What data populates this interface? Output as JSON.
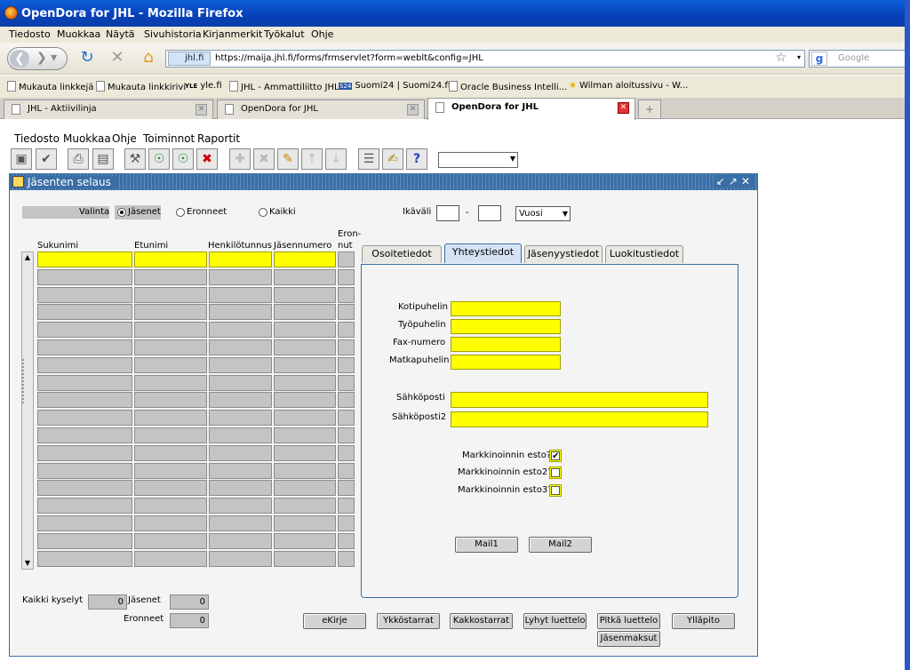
{
  "window": {
    "title": "OpenDora for JHL - Mozilla Firefox"
  },
  "browser_menu": [
    "Tiedosto",
    "Muokkaa",
    "Näytä",
    "Sivuhistoria",
    "Kirjanmerkit",
    "Työkalut",
    "Ohje"
  ],
  "address": {
    "site": "jhl.fi",
    "url": "https://maija.jhl.fi/forms/frmservlet?form=weblt&config=JHL"
  },
  "search": {
    "placeholder": "Google"
  },
  "bookmarks": [
    "Mukauta linkkejä",
    "Mukauta linkkirivi",
    "yle.fi",
    "JHL - Ammattiliitto JHL",
    "Suomi24 | Suomi24.fi",
    "Oracle Business Intelli...",
    "Wilman aloitussivu - W..."
  ],
  "bookmark_badges": {
    "yle": "YLE",
    "s24": "S24"
  },
  "tabs": [
    "JHL - Aktiivilinja",
    "OpenDora for JHL",
    "OpenDora for JHL"
  ],
  "app_menu": [
    "Tiedosto",
    "Muokkaa",
    "Ohje",
    "Toiminnot",
    "Raportit"
  ],
  "form": {
    "title": "Jäsenten selaus",
    "valinta_label": "Valinta",
    "radio_options": [
      "Jäsenet",
      "Eronneet",
      "Kaikki"
    ],
    "radio_selected": "Jäsenet",
    "ikavali_label": "Ikäväli",
    "ikavali_sep": "-",
    "ikavali_unit": "Vuosi",
    "columns": [
      "Sukunimi",
      "Etunimi",
      "Henkilötunnus",
      "Jäsennumero",
      "Eron-\nnut"
    ],
    "row_count": 18,
    "tabs": [
      "Osoitetiedot",
      "Yhteystiedot",
      "Jäsenyystiedot",
      "Luokitustiedot"
    ],
    "active_tab": "Yhteystiedot",
    "contact_labels": [
      "Kotipuhelin",
      "Työpuhelin",
      "Fax-numero",
      "Matkapuhelin"
    ],
    "email_labels": [
      "Sähköposti",
      "Sähköposti2"
    ],
    "checkboxes": [
      {
        "label": "Markkinoinnin esto?",
        "checked": true
      },
      {
        "label": "Markkinoinnin esto2?",
        "checked": false
      },
      {
        "label": "Markkinoinnin esto3?",
        "checked": false
      }
    ],
    "mail_buttons": [
      "Mail1",
      "Mail2"
    ],
    "totals": {
      "kaikki_label": "Kaikki kyselyt",
      "kaikki_value": "0",
      "jasenet_label": "Jäsenet",
      "jasenet_value": "0",
      "eronneet_label": "Eronneet",
      "eronneet_value": "0"
    },
    "bottom_buttons": [
      "eKirje",
      "Ykköstarrat",
      "Kakkostarrat",
      "Lyhyt luettelo",
      "Pitkä luettelo",
      "Ylläpito",
      "Jäsenmaksut"
    ]
  },
  "colors": {
    "accent": "#3a6ea5",
    "required_field": "#ffff00",
    "field_gray": "#c4c4c4"
  }
}
